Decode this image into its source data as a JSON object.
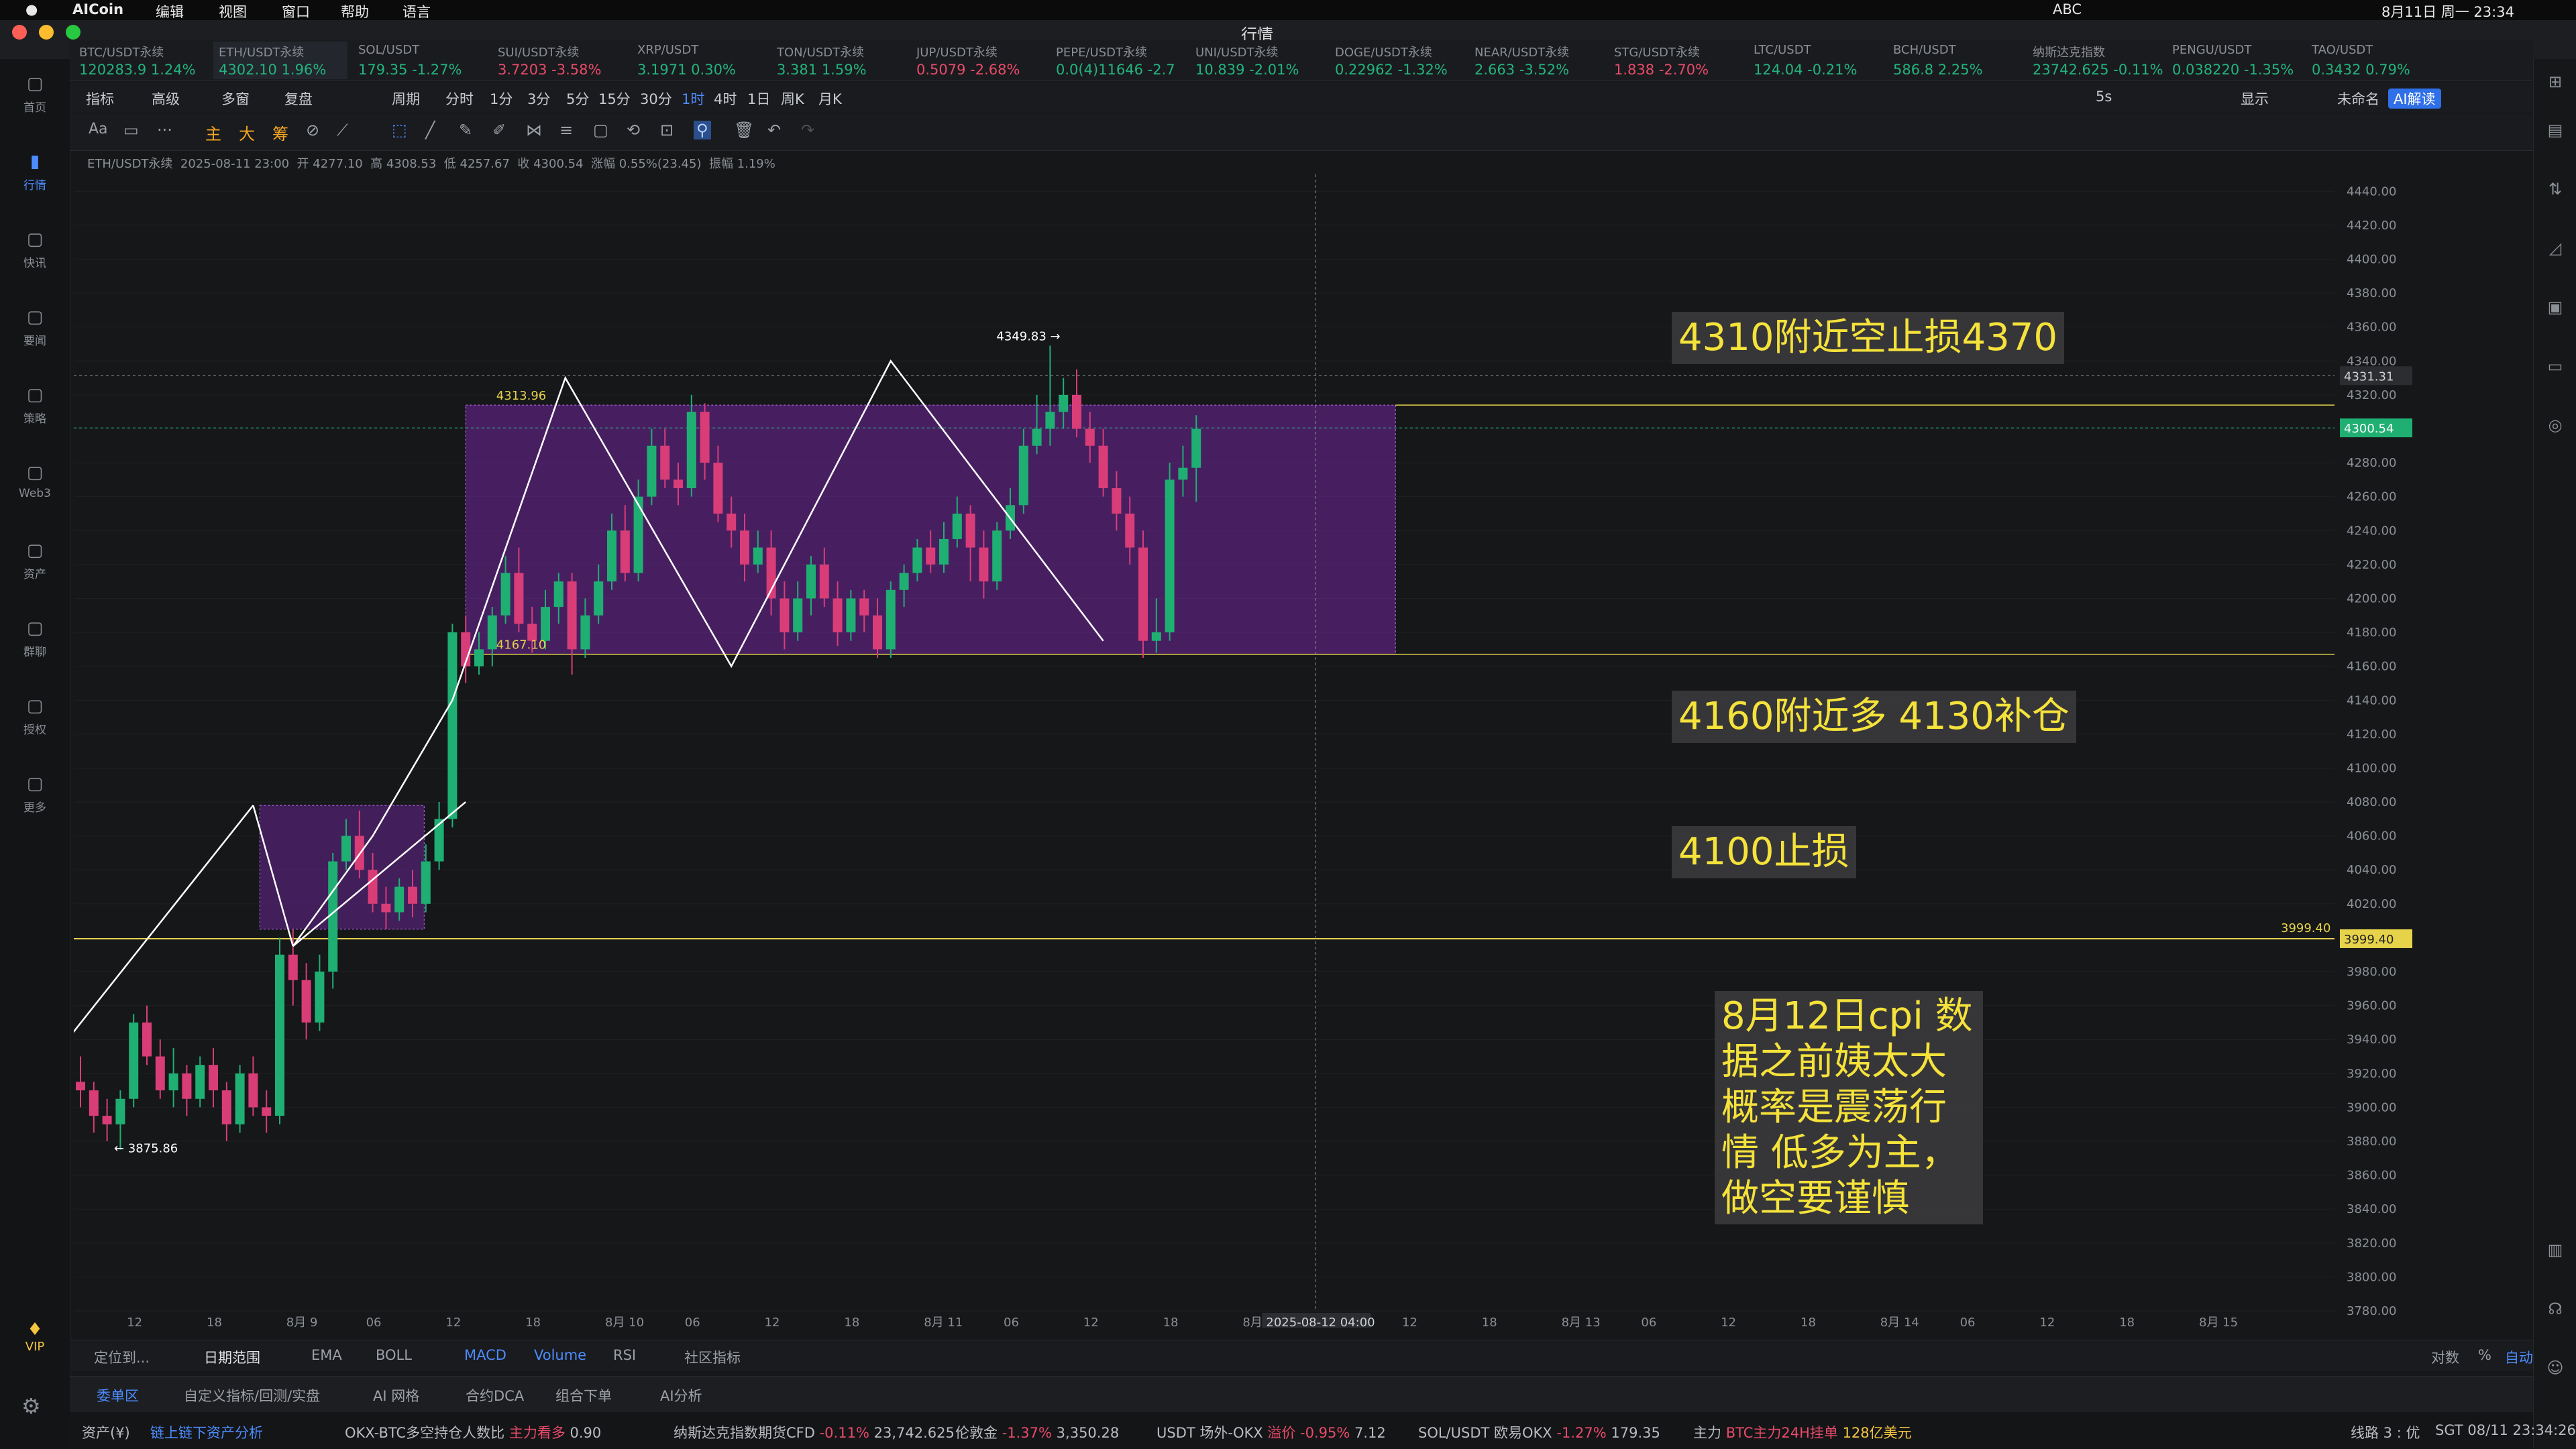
{
  "menubar": {
    "app": "AICoin",
    "items": [
      "编辑",
      "视图",
      "窗口",
      "帮助",
      "语言"
    ],
    "clock": "8月11日 周一  23:34",
    "input": "ABC"
  },
  "window": {
    "title": "行情"
  },
  "nav": [
    {
      "label": "首页",
      "icon": "home-icon"
    },
    {
      "label": "行情",
      "icon": "chart-icon",
      "active": true
    },
    {
      "label": "快讯",
      "icon": "news-icon"
    },
    {
      "label": "要闻",
      "icon": "article-icon"
    },
    {
      "label": "策略",
      "icon": "strategy-icon"
    },
    {
      "label": "Web3",
      "icon": "web3-icon"
    },
    {
      "label": "资产",
      "icon": "wallet-icon"
    },
    {
      "label": "群聊",
      "icon": "chat-icon"
    },
    {
      "label": "授权",
      "icon": "auth-icon"
    },
    {
      "label": "更多",
      "icon": "more-icon"
    }
  ],
  "vip_label": "VIP",
  "tickers": [
    {
      "name": "BTC/USDT永续",
      "price": "120283.9",
      "chg": "1.24%",
      "dir": "up"
    },
    {
      "name": "ETH/USDT永续",
      "price": "4302.10",
      "chg": "1.96%",
      "dir": "up",
      "selected": true
    },
    {
      "name": "SOL/USDT",
      "price": "179.35",
      "chg": "-1.27%",
      "dir": "up"
    },
    {
      "name": "SUI/USDT永续",
      "price": "3.7203",
      "chg": "-3.58%",
      "dir": "dn"
    },
    {
      "name": "XRP/USDT",
      "price": "3.1971",
      "chg": "0.30%",
      "dir": "up"
    },
    {
      "name": "TON/USDT永续",
      "price": "3.381",
      "chg": "1.59%",
      "dir": "up"
    },
    {
      "name": "JUP/USDT永续",
      "price": "0.5079",
      "chg": "-2.68%",
      "dir": "dn"
    },
    {
      "name": "PEPE/USDT永续",
      "price": "0.0(4)11646",
      "chg": "-2.7",
      "dir": "up"
    },
    {
      "name": "UNI/USDT永续",
      "price": "10.839",
      "chg": "-2.01%",
      "dir": "up"
    },
    {
      "name": "DOGE/USDT永续",
      "price": "0.22962",
      "chg": "-1.32%",
      "dir": "up"
    },
    {
      "name": "NEAR/USDT永续",
      "price": "2.663",
      "chg": "-3.52%",
      "dir": "up"
    },
    {
      "name": "STG/USDT永续",
      "price": "1.838",
      "chg": "-2.70%",
      "dir": "dn"
    },
    {
      "name": "LTC/USDT",
      "price": "124.04",
      "chg": "-0.21%",
      "dir": "up"
    },
    {
      "name": "BCH/USDT",
      "price": "586.8",
      "chg": "2.25%",
      "dir": "up"
    },
    {
      "name": "纳斯达克指数",
      "price": "23742.625",
      "chg": "-0.11%",
      "dir": "up"
    },
    {
      "name": "PENGU/USDT",
      "price": "0.038220",
      "chg": "-1.35%",
      "dir": "up"
    },
    {
      "name": "TAO/USDT",
      "price": "0.3432",
      "chg": "0.79%",
      "dir": "up"
    }
  ],
  "toolbar": {
    "items": [
      "指标",
      "高级",
      "多窗",
      "复盘",
      "",
      "周期",
      "分时",
      "1分",
      "3分",
      "5分",
      "15分",
      "30分",
      "1时",
      "4时",
      "1日",
      "周K",
      "月K"
    ],
    "selected": "1时",
    "right": [
      "5s",
      "显示",
      "未命名",
      "AI解读"
    ]
  },
  "drawtools": [
    "Aa",
    "主",
    "大",
    "筹"
  ],
  "ohlc": {
    "symbol": "ETH/USDT永续",
    "time": "2025-08-11 23:00",
    "open": "开 4277.10",
    "high": "高 4308.53",
    "low": "低 4257.67",
    "close": "收 4300.54",
    "chg": "涨幅 0.55%(23.45)",
    "amp": "振幅 1.19%"
  },
  "chart_data": {
    "type": "candlestick",
    "symbol": "ETH/USDT永续",
    "interval": "1时",
    "ylim": [
      3780,
      4450
    ],
    "y_ticks": [
      4440,
      4420,
      4400,
      4380,
      4360,
      4340,
      4320,
      4300,
      4280,
      4260,
      4240,
      4220,
      4200,
      4180,
      4160,
      4140,
      4120,
      4100,
      4080,
      4060,
      4040,
      4020,
      4000,
      3980,
      3960,
      3940,
      3920,
      3900,
      3880,
      3860,
      3840,
      3820,
      3800,
      3780
    ],
    "x_ticks": [
      {
        "label": "12",
        "i": 4
      },
      {
        "label": "18",
        "i": 10
      },
      {
        "label": "8月 9",
        "i": 16
      },
      {
        "label": "06",
        "i": 22
      },
      {
        "label": "12",
        "i": 28
      },
      {
        "label": "18",
        "i": 34
      },
      {
        "label": "8月 10",
        "i": 40
      },
      {
        "label": "06",
        "i": 46
      },
      {
        "label": "12",
        "i": 52
      },
      {
        "label": "18",
        "i": 58
      },
      {
        "label": "8月 11",
        "i": 64
      },
      {
        "label": "06",
        "i": 70
      },
      {
        "label": "12",
        "i": 76
      },
      {
        "label": "18",
        "i": 82
      },
      {
        "label": "8月",
        "i": 88
      },
      {
        "label": "12",
        "i": 100
      },
      {
        "label": "18",
        "i": 106
      },
      {
        "label": "8月 13",
        "i": 112
      },
      {
        "label": "06",
        "i": 118
      },
      {
        "label": "12",
        "i": 124
      },
      {
        "label": "18",
        "i": 130
      },
      {
        "label": "8月 14",
        "i": 136
      },
      {
        "label": "06",
        "i": 142
      },
      {
        "label": "12",
        "i": 148
      },
      {
        "label": "18",
        "i": 154
      },
      {
        "label": "8月 15",
        "i": 160
      }
    ],
    "crosshair_label": "2025-08-12 04:00",
    "price_labels": {
      "last": "4300.54",
      "cross": "4331.31",
      "level": "3999.40",
      "level_left": "3999.40"
    },
    "box_labels": {
      "top": "4313.96",
      "bottom": "4167.10"
    },
    "markers": {
      "high": "4349.83",
      "low": "3875.86"
    },
    "candles": [
      [
        3915,
        3910,
        3930,
        3900
      ],
      [
        3910,
        3895,
        3915,
        3885
      ],
      [
        3895,
        3890,
        3905,
        3880
      ],
      [
        3890,
        3905,
        3910,
        3875
      ],
      [
        3905,
        3950,
        3955,
        3900
      ],
      [
        3950,
        3930,
        3960,
        3925
      ],
      [
        3930,
        3910,
        3940,
        3905
      ],
      [
        3910,
        3920,
        3935,
        3900
      ],
      [
        3920,
        3905,
        3925,
        3895
      ],
      [
        3905,
        3925,
        3930,
        3900
      ],
      [
        3925,
        3910,
        3935,
        3900
      ],
      [
        3910,
        3890,
        3915,
        3880
      ],
      [
        3890,
        3920,
        3925,
        3885
      ],
      [
        3920,
        3900,
        3930,
        3895
      ],
      [
        3900,
        3895,
        3910,
        3885
      ],
      [
        3895,
        3990,
        4000,
        3890
      ],
      [
        3990,
        3975,
        4005,
        3960
      ],
      [
        3975,
        3950,
        3985,
        3940
      ],
      [
        3950,
        3980,
        3990,
        3945
      ],
      [
        3980,
        4045,
        4050,
        3970
      ],
      [
        4045,
        4060,
        4070,
        4040
      ],
      [
        4060,
        4040,
        4075,
        4035
      ],
      [
        4040,
        4020,
        4050,
        4015
      ],
      [
        4020,
        4015,
        4030,
        4005
      ],
      [
        4015,
        4030,
        4035,
        4010
      ],
      [
        4030,
        4020,
        4040,
        4012
      ],
      [
        4020,
        4045,
        4055,
        4015
      ],
      [
        4045,
        4070,
        4080,
        4040
      ],
      [
        4070,
        4180,
        4185,
        4065
      ],
      [
        4180,
        4160,
        4190,
        4150
      ],
      [
        4160,
        4170,
        4180,
        4155
      ],
      [
        4170,
        4190,
        4195,
        4160
      ],
      [
        4190,
        4215,
        4225,
        4185
      ],
      [
        4215,
        4185,
        4230,
        4180
      ],
      [
        4185,
        4175,
        4195,
        4168
      ],
      [
        4175,
        4195,
        4205,
        4170
      ],
      [
        4195,
        4210,
        4215,
        4185
      ],
      [
        4210,
        4170,
        4215,
        4155
      ],
      [
        4170,
        4190,
        4200,
        4165
      ],
      [
        4190,
        4210,
        4220,
        4185
      ],
      [
        4210,
        4240,
        4250,
        4205
      ],
      [
        4240,
        4215,
        4255,
        4210
      ],
      [
        4215,
        4260,
        4270,
        4210
      ],
      [
        4260,
        4290,
        4300,
        4255
      ],
      [
        4290,
        4270,
        4300,
        4265
      ],
      [
        4270,
        4265,
        4280,
        4255
      ],
      [
        4265,
        4310,
        4320,
        4260
      ],
      [
        4310,
        4280,
        4315,
        4270
      ],
      [
        4280,
        4250,
        4290,
        4245
      ],
      [
        4250,
        4240,
        4260,
        4230
      ],
      [
        4240,
        4220,
        4250,
        4210
      ],
      [
        4220,
        4230,
        4240,
        4215
      ],
      [
        4230,
        4200,
        4240,
        4190
      ],
      [
        4200,
        4180,
        4210,
        4170
      ],
      [
        4180,
        4200,
        4210,
        4175
      ],
      [
        4200,
        4220,
        4225,
        4190
      ],
      [
        4220,
        4200,
        4230,
        4195
      ],
      [
        4200,
        4180,
        4210,
        4172
      ],
      [
        4180,
        4200,
        4205,
        4175
      ],
      [
        4200,
        4190,
        4205,
        4180
      ],
      [
        4190,
        4170,
        4200,
        4165
      ],
      [
        4170,
        4205,
        4210,
        4165
      ],
      [
        4205,
        4215,
        4220,
        4195
      ],
      [
        4215,
        4230,
        4235,
        4210
      ],
      [
        4230,
        4220,
        4240,
        4215
      ],
      [
        4220,
        4235,
        4245,
        4215
      ],
      [
        4235,
        4250,
        4260,
        4230
      ],
      [
        4250,
        4230,
        4255,
        4210
      ],
      [
        4230,
        4210,
        4240,
        4200
      ],
      [
        4210,
        4240,
        4245,
        4205
      ],
      [
        4240,
        4255,
        4265,
        4235
      ],
      [
        4255,
        4290,
        4300,
        4250
      ],
      [
        4290,
        4300,
        4320,
        4285
      ],
      [
        4300,
        4310,
        4349,
        4290
      ],
      [
        4310,
        4320,
        4330,
        4300
      ],
      [
        4320,
        4300,
        4335,
        4295
      ],
      [
        4300,
        4290,
        4310,
        4280
      ],
      [
        4290,
        4265,
        4300,
        4260
      ],
      [
        4265,
        4250,
        4275,
        4240
      ],
      [
        4250,
        4230,
        4260,
        4220
      ],
      [
        4230,
        4175,
        4240,
        4165
      ],
      [
        4175,
        4180,
        4200,
        4168
      ],
      [
        4180,
        4270,
        4280,
        4175
      ],
      [
        4270,
        4277,
        4290,
        4260
      ],
      [
        4277,
        4300,
        4308,
        4257
      ]
    ]
  },
  "annotations": {
    "a1": "4310附近空止损4370",
    "a2": "4160附近多 4130补仓",
    "a3": "4100止损",
    "a4": "8月12日cpi 数据之前姨太大概率是震荡行情 低多为主，做空要谨慎"
  },
  "bottom_tabs": {
    "locate": "定位到...",
    "range": "日期范围",
    "ema": "EMA",
    "boll": "BOLL",
    "macd": "MACD",
    "volume": "Volume",
    "rsi": "RSI",
    "community": "社区指标",
    "log": "对数",
    "pct": "%",
    "auto": "自动"
  },
  "panel_tabs": [
    "委单区",
    "自定义指标/回测/实盘",
    "AI 网格",
    "合约DCA",
    "组合下单",
    "AI分析"
  ],
  "status": {
    "asset": "资产(¥)",
    "chain": "链上链下资产分析",
    "items": [
      {
        "name": "OKX-BTC多空持仓人数比",
        "tag": "主力看多",
        "val": "0.90"
      },
      {
        "name": "纳斯达克指数期货CFD",
        "chg": "-0.11%",
        "val": "23,742.625"
      },
      {
        "name": "伦敦金",
        "chg": "-1.37%",
        "val": "3,350.28"
      },
      {
        "name": "USDT 场外-OKX",
        "tag": "溢价 -0.95%",
        "val": "7.12"
      },
      {
        "name": "SOL/USDT 欧易OKX",
        "chg": "-1.27%",
        "val": "179.35"
      },
      {
        "name": "主力",
        "tag": "BTC主力24H挂单",
        "val": "128亿美元"
      }
    ],
    "line": "线路 3 : 优",
    "time": "SGT 08/11 23:34:26"
  }
}
